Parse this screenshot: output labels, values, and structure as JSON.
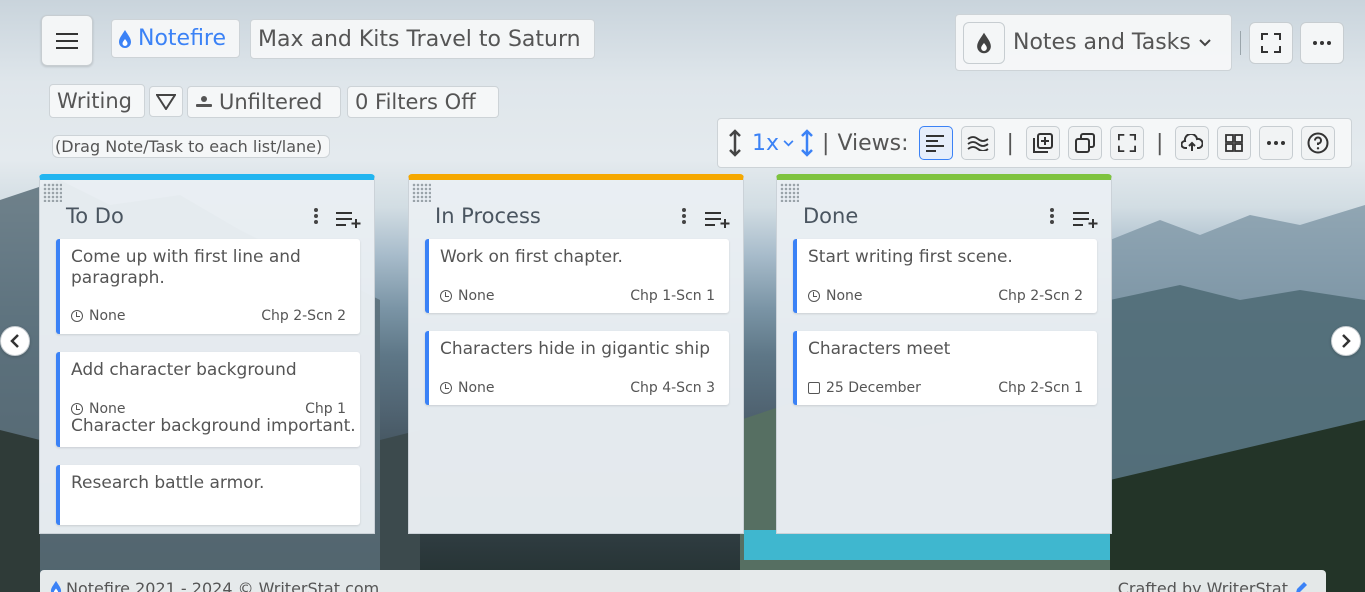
{
  "header": {
    "app_name": "Notefire",
    "project_title": "Max and Kits Travel to Saturn",
    "view_selector_label": "Notes and Tasks"
  },
  "toolbar": {
    "category": "Writing",
    "filter_status": "Unfiltered",
    "filters_off": "0 Filters Off",
    "hint": "(Drag Note/Task to each list/lane)",
    "zoom": "1x",
    "views_label": "Views:"
  },
  "lanes": [
    {
      "title": "To Do",
      "accent": "#22b5f0",
      "cards": [
        {
          "title": "Come up with first line and paragraph.",
          "due": "None",
          "chapter": "Chp 2-Scn 2",
          "note": ""
        },
        {
          "title": "Add character background",
          "due": "None",
          "chapter": "Chp 1",
          "note": "Character background important."
        },
        {
          "title": "Research battle armor.",
          "due": "",
          "chapter": "",
          "note": ""
        }
      ]
    },
    {
      "title": "In Process",
      "accent": "#f5a800",
      "cards": [
        {
          "title": "Work on first chapter.",
          "due": "None",
          "chapter": "Chp 1-Scn 1",
          "note": ""
        },
        {
          "title": "Characters hide in gigantic ship",
          "due": "None",
          "chapter": "Chp 4-Scn 3",
          "note": ""
        }
      ]
    },
    {
      "title": "Done",
      "accent": "#7ec33f",
      "cards": [
        {
          "title": "Start writing first scene.",
          "due": "None",
          "chapter": "Chp 2-Scn 2",
          "note": ""
        },
        {
          "title": "Characters meet",
          "due": "25 December",
          "chapter": "Chp 2-Scn 1",
          "note": ""
        }
      ]
    }
  ],
  "footer": {
    "copyright": "Notefire 2021 - 2024 ©  WriterStat.com",
    "credit": "Crafted by WriterStat"
  },
  "colors": {
    "accent_blue": "#3b82f6"
  }
}
